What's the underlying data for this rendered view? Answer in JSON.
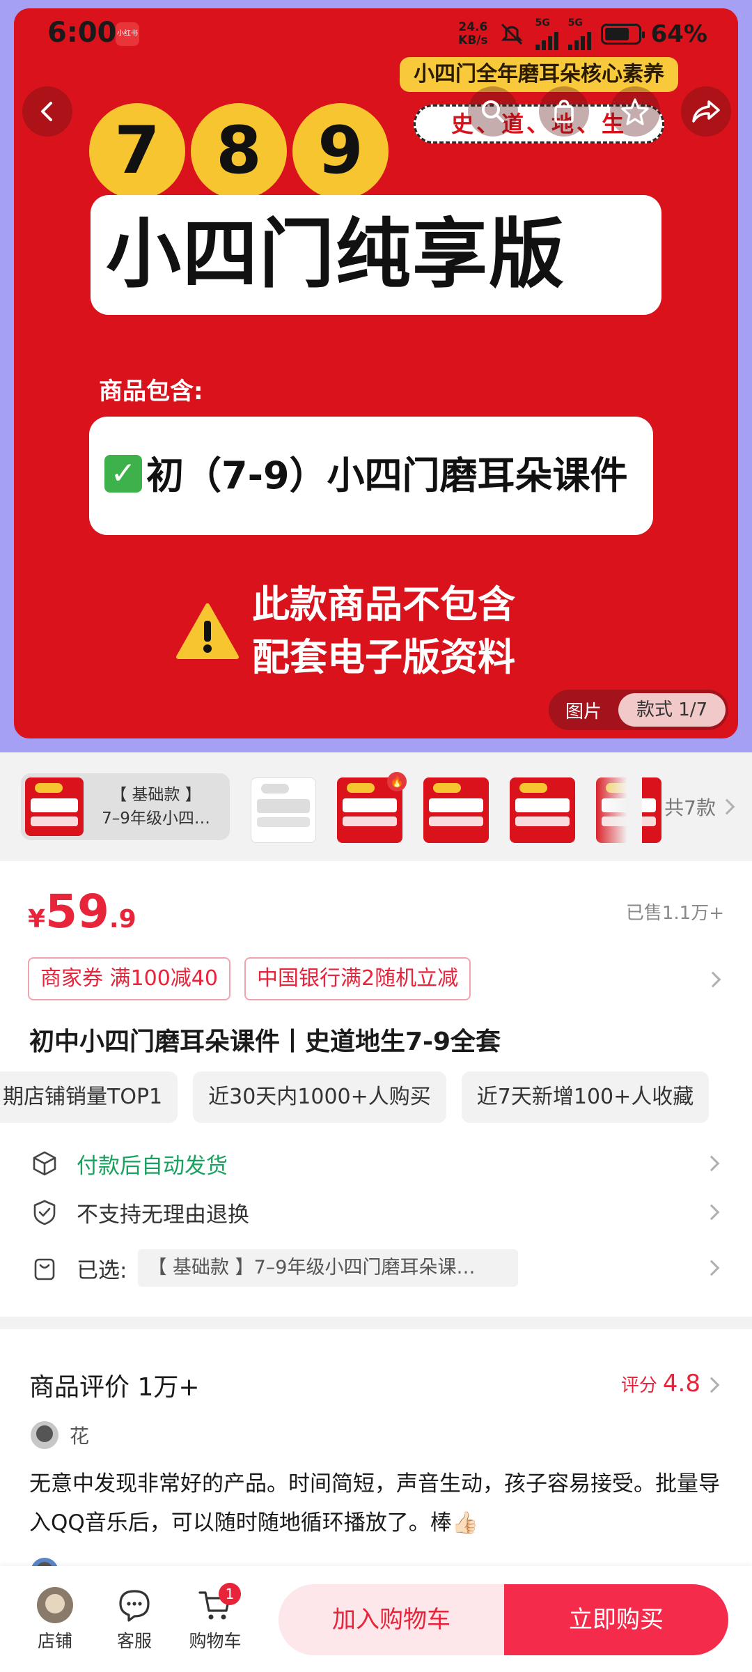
{
  "status_bar": {
    "time": "6:00",
    "app_icon": "小红书",
    "net_speed_value": "24.6",
    "net_speed_unit": "KB/s",
    "signal_1": "5G",
    "signal_2": "5G",
    "battery": "64%"
  },
  "hero": {
    "core_tag": "小四门全年磨耳朵核心素养",
    "subjects": "史、道、地、生",
    "grades": [
      "7",
      "8",
      "9"
    ],
    "title": "小四门纯享版",
    "includes_label": "商品包含:",
    "course_item": "初（7-9）小四门磨耳朵课件",
    "warning_line1": "此款商品不包含",
    "warning_line2": "配套电子版资料",
    "pager_pic": "图片",
    "pager_style": "款式 1/7"
  },
  "variants": {
    "selected_line1": "【 基础款 】",
    "selected_line2": "7–9年级小四…",
    "count_label": "共7款"
  },
  "price": {
    "symbol": "¥",
    "integer": "59",
    "decimal": ".9",
    "sold": "已售1.1万+"
  },
  "coupons": [
    "商家券 满100减40",
    "中国银行满2随机立减"
  ],
  "product_title": "初中小四门磨耳朵课件丨史道地生7-9全套",
  "badges": [
    "期店铺销量TOP1",
    "近30天内1000+人购买",
    "近7天新增100+人收藏"
  ],
  "services": {
    "auto_ship": "付款后自动发货",
    "no_return": "不支持无理由退换",
    "selected_label": "已选:",
    "selected_value": "【 基础款 】7–9年级小四门磨耳朵课…"
  },
  "reviews": {
    "title": "商品评价 1万+",
    "rating_label": "评分",
    "rating_value": "4.8",
    "reviewer_name": "花",
    "review_text": "无意中发现非常好的产品。时间简短，声音生动，孩子容易接受。批量导入QQ音乐后，可以随时随地循环播放了。棒👍🏻"
  },
  "bottom_bar": {
    "store_label": "店铺",
    "cs_label": "客服",
    "cart_label": "购物车",
    "cart_count": "1",
    "add_to_cart": "加入购物车",
    "buy_now": "立即购买"
  },
  "colors": {
    "accent": "#e8243b",
    "hero_red": "#d9121b",
    "hero_bg": "#a6a0f5",
    "yellow": "#f6c52f",
    "green": "#19a15f"
  }
}
